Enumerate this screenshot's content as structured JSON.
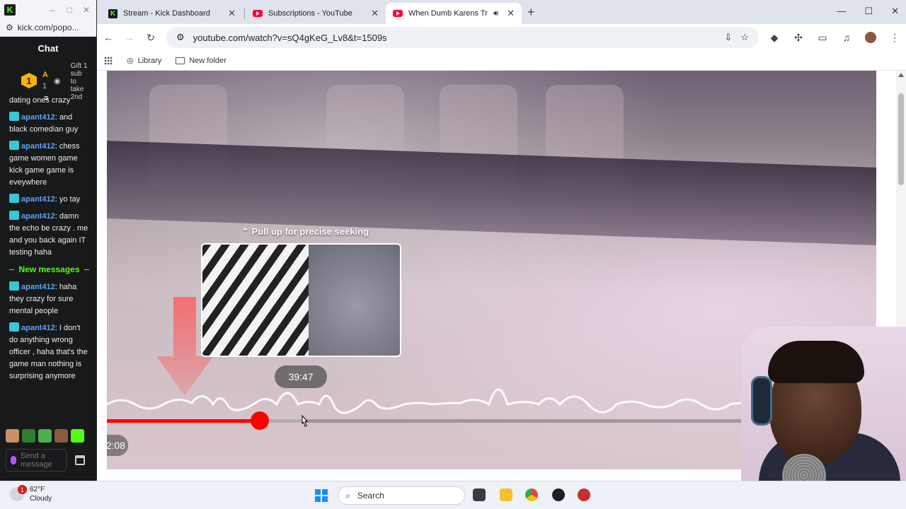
{
  "kick": {
    "url": "kick.com/popo...",
    "chat_title": "Chat",
    "gift": {
      "badge": "1",
      "user_initial": "A",
      "user_count": "1",
      "text": "Gift 1 sub to take 2nd"
    },
    "partial_message": "dating ones crazy",
    "messages_before": [
      {
        "user": "apant412",
        "text": ": and black comedian guy"
      },
      {
        "user": "apant412",
        "text": ": chess game women game kick game game is eveywhere"
      },
      {
        "user": "apant412",
        "text": ": yo tay"
      },
      {
        "user": "apant412",
        "text": ": damn the echo be crazy . me and you back again IT testing haha"
      }
    ],
    "new_messages_label": "New messages",
    "messages_after": [
      {
        "user": "apant412",
        "text": ": haha they crazy for sure mental people"
      },
      {
        "user": "apant412",
        "text": ": I don't do anything wrong officer , haha that's the game man nothing is surprising anymore"
      }
    ],
    "input_placeholder": "Send a message"
  },
  "browser": {
    "tabs": [
      {
        "title": "Stream - Kick Dashboard",
        "favicon": "kick-icon"
      },
      {
        "title": "Subscriptions - YouTube",
        "favicon": "youtube-icon"
      },
      {
        "title": "When Dumb Karens Try To",
        "favicon": "youtube-icon",
        "active": true,
        "audio": true
      }
    ],
    "url": "youtube.com/watch?v=sQ4gKeG_Lv8&t=1509s",
    "bookmarks": [
      {
        "label": "Library",
        "icon": "library-icon"
      },
      {
        "label": "New folder",
        "icon": "folder-icon"
      }
    ]
  },
  "video": {
    "seek_hint": "Pull up for precise seeking",
    "preview_time": "39:47",
    "current_time": "2:08",
    "progress_fraction": 0.21,
    "buffer_fraction": 0.27,
    "accent_color": "#ff0000"
  },
  "taskbar": {
    "notification_count": "1",
    "temperature": "62°F",
    "condition": "Cloudy",
    "search_label": "Search"
  }
}
